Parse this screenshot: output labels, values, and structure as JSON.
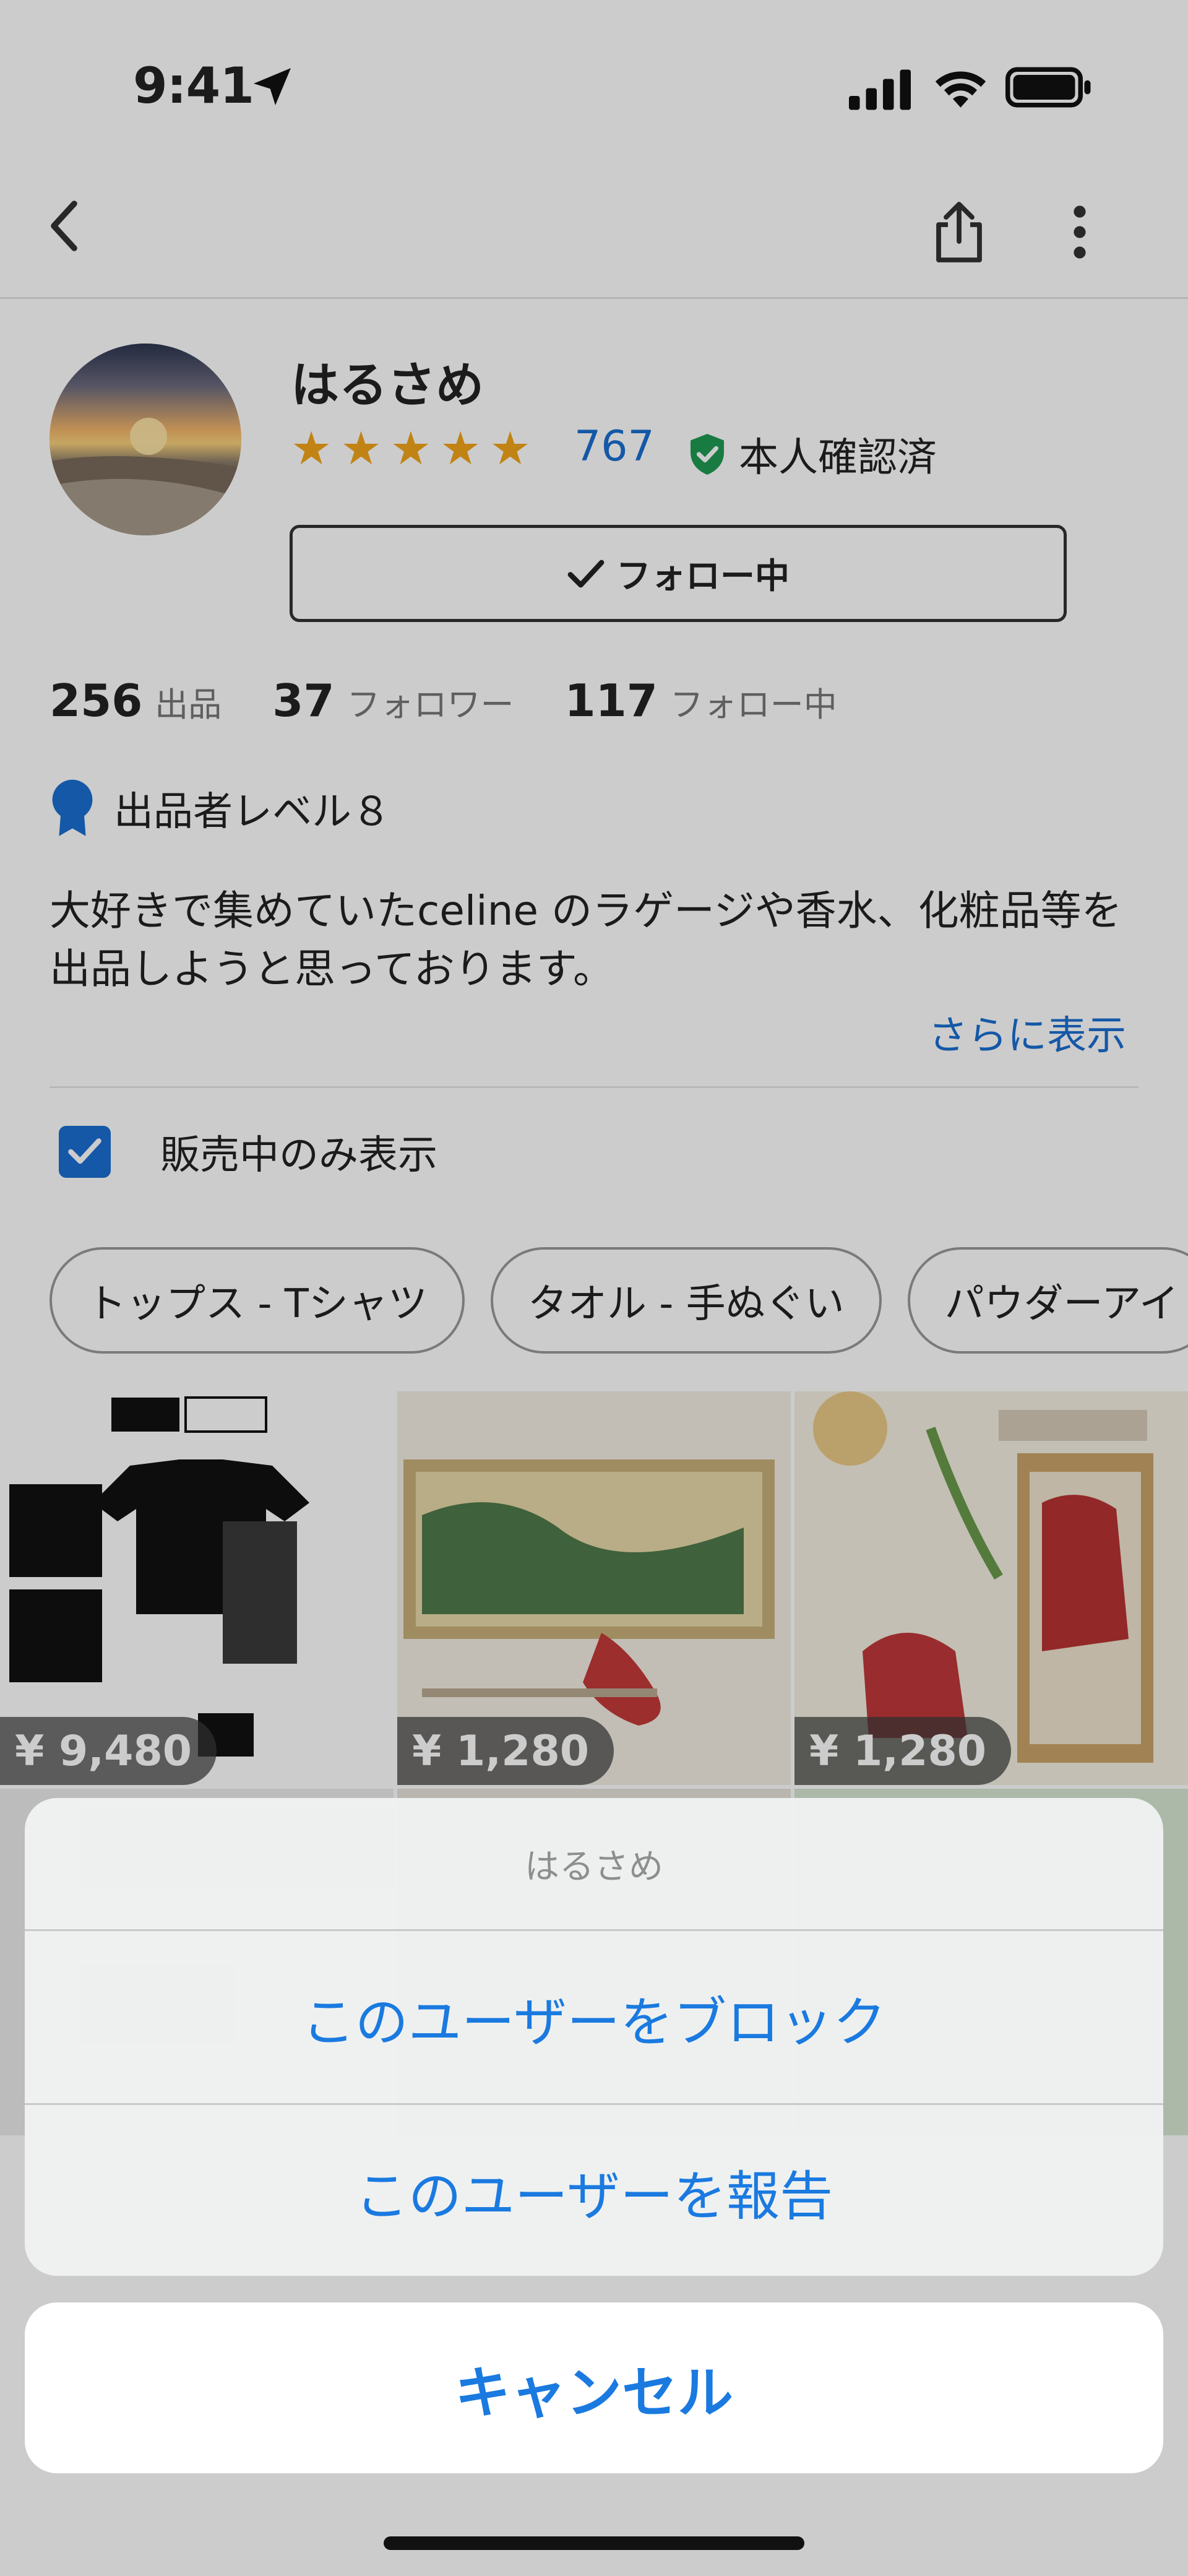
{
  "status_bar": {
    "time": "9:41"
  },
  "profile": {
    "username": "はるさめ",
    "rating_count": "767",
    "verified_label": "本人確認済",
    "follow_button": "フォロー中",
    "stats": [
      {
        "value": "256",
        "label": "出品"
      },
      {
        "value": "37",
        "label": "フォロワー"
      },
      {
        "value": "117",
        "label": "フォロー中"
      }
    ],
    "seller_level": "出品者レベル８",
    "bio": "大好きで集めていたceline のラゲージや香水、化粧品等を出品しようと思っております。",
    "show_more": "さらに表示",
    "on_sale_only": "販売中のみ表示"
  },
  "categories": [
    "トップス - Tシャツ",
    "タオル - 手ぬぐい",
    "パウダーアイ"
  ],
  "items": [
    {
      "price": "¥ 9,480",
      "color": "#ffffff"
    },
    {
      "price": "¥ 1,280",
      "color": "#f3eee4"
    },
    {
      "price": "¥ 1,280",
      "color": "#f4efe2"
    }
  ],
  "action_sheet": {
    "title": "はるさめ",
    "block": "このユーザーをブロック",
    "report": "このユーザーを報告",
    "cancel": "キャンセル"
  },
  "colors": {
    "accent": "#1a6fd1",
    "star": "#f2a41a",
    "verified": "#1f9a52"
  }
}
